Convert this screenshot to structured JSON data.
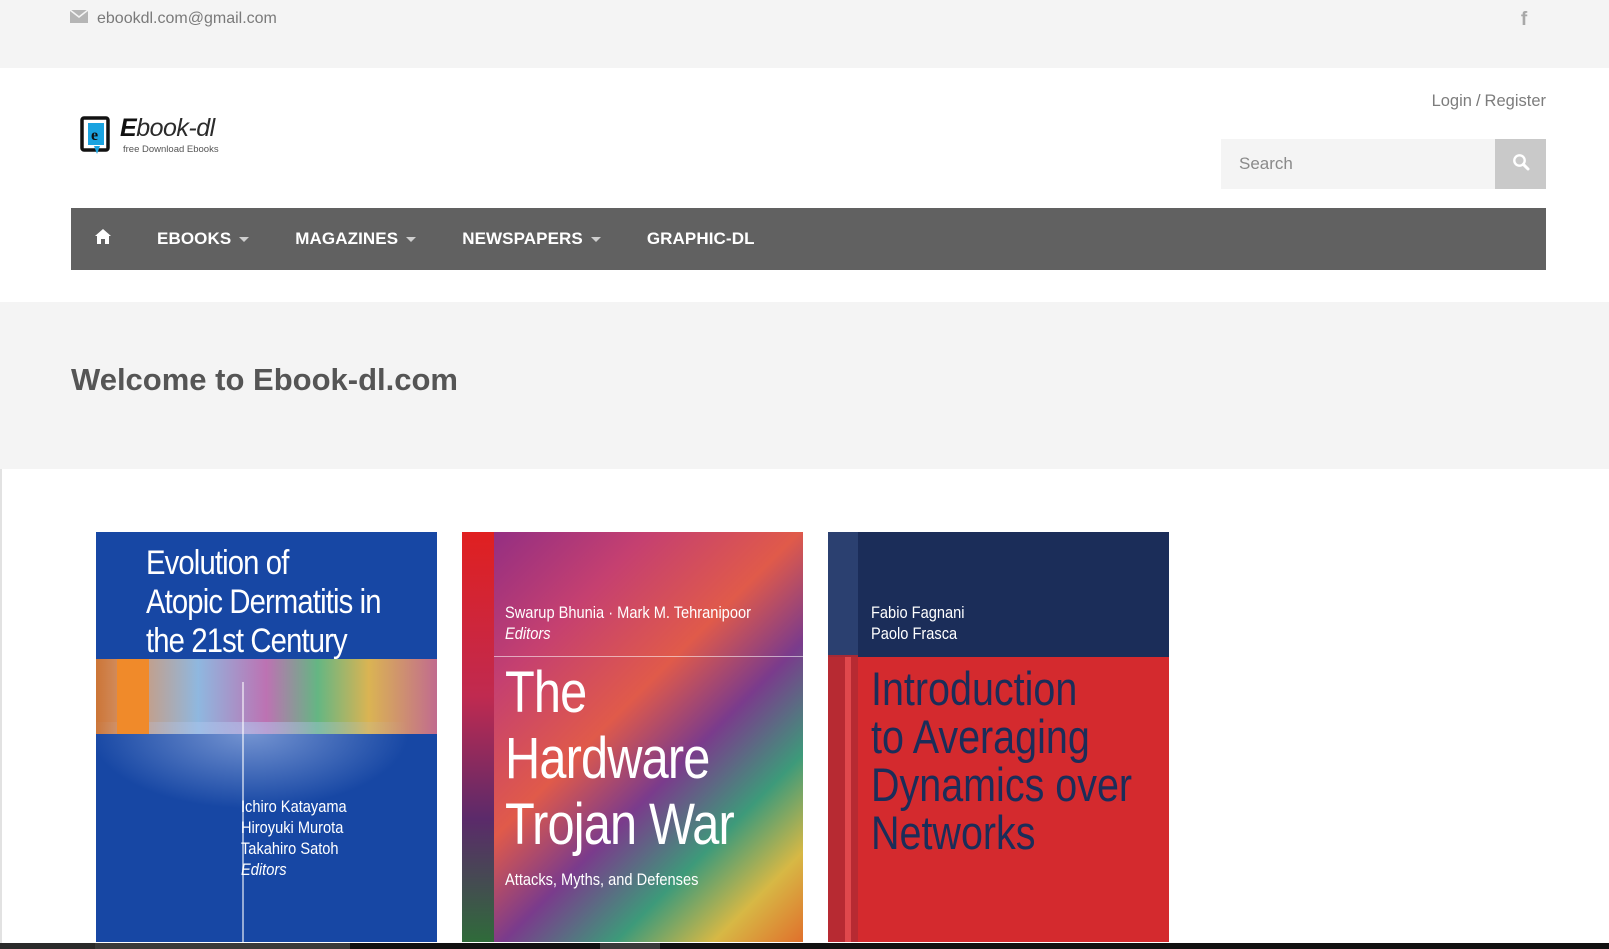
{
  "topbar": {
    "email": "ebookdl.com@gmail.com",
    "social": "f"
  },
  "header": {
    "logo": {
      "name_prefix": "E",
      "name_rest": "book-dl",
      "tagline": "free Download Ebooks"
    },
    "auth": {
      "login": "Login",
      "separator": "/",
      "register": "Register"
    },
    "search": {
      "placeholder": "Search"
    }
  },
  "nav": {
    "items": [
      {
        "label": "EBOOKS",
        "has_dropdown": true
      },
      {
        "label": "MAGAZINES",
        "has_dropdown": true
      },
      {
        "label": "NEWSPAPERS",
        "has_dropdown": true
      },
      {
        "label": "GRAPHIC-DL",
        "has_dropdown": false
      }
    ]
  },
  "welcome": {
    "title": "Welcome to Ebook-dl.com"
  },
  "books": [
    {
      "title_lines": [
        "Evolution of",
        "Atopic Dermatitis in",
        "the 21st Century"
      ],
      "editors": [
        "Ichiro Katayama",
        "Hiroyuki Murota",
        "Takahiro Satoh"
      ],
      "editors_role": "Editors"
    },
    {
      "editors_line": "Swarup Bhunia · Mark M. Tehranipoor",
      "editors_role": "Editors",
      "title_lines": [
        "The",
        "Hardware",
        "Trojan War"
      ],
      "subtitle": "Attacks, Myths, and Defenses"
    },
    {
      "authors": [
        "Fabio Fagnani",
        "Paolo Frasca"
      ],
      "title_lines": [
        "Introduction",
        "to Averaging",
        "Dynamics over",
        "Networks"
      ]
    }
  ],
  "colors": {
    "nav_bg": "#616161",
    "band_bg": "#f4f4f4",
    "welcome_text": "#555555"
  }
}
